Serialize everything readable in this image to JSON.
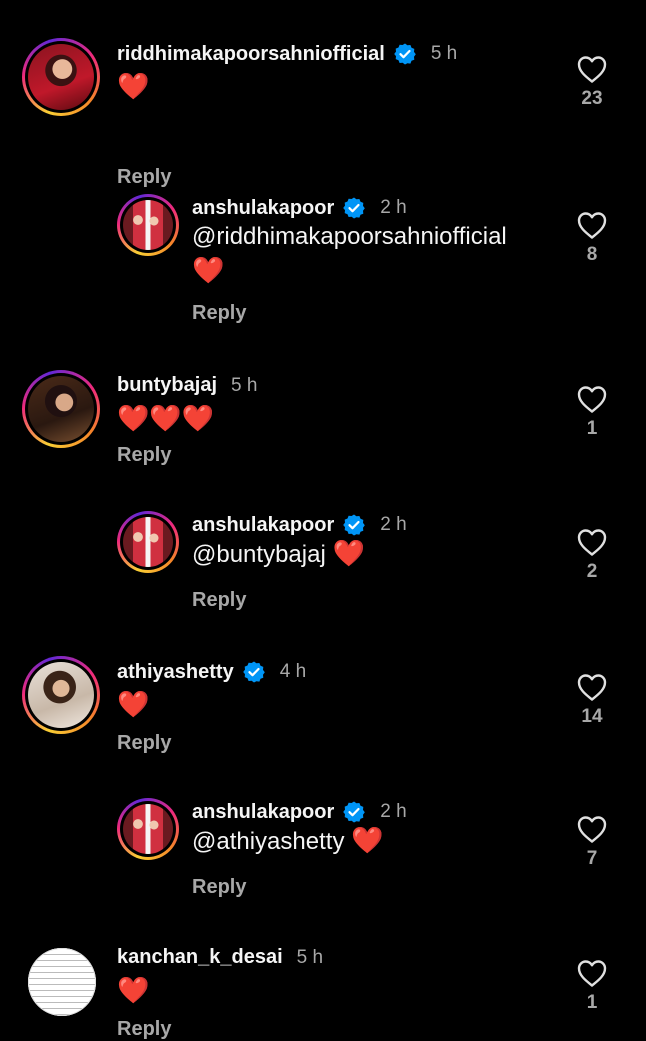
{
  "comments": [
    {
      "username": "riddhimakapoorsahniofficial",
      "verified": true,
      "time": "5 h",
      "body": "❤️",
      "reply_label": "Reply",
      "likes": "23"
    },
    {
      "username": "anshulakapoor",
      "verified": true,
      "time": "2 h",
      "mention": "@riddhimakapoorsahniofficial",
      "body": "❤️",
      "reply_label": "Reply",
      "likes": "8"
    },
    {
      "username": "buntybajaj",
      "verified": false,
      "time": "5 h",
      "body": "❤️❤️❤️",
      "reply_label": "Reply",
      "likes": "1"
    },
    {
      "username": "anshulakapoor",
      "verified": true,
      "time": "2 h",
      "mention": "@buntybajaj",
      "body": "❤️",
      "reply_label": "Reply",
      "likes": "2"
    },
    {
      "username": "athiyashetty",
      "verified": true,
      "time": "4 h",
      "body": "❤️",
      "reply_label": "Reply",
      "likes": "14"
    },
    {
      "username": "anshulakapoor",
      "verified": true,
      "time": "2 h",
      "mention": "@athiyashetty",
      "body": "❤️",
      "reply_label": "Reply",
      "likes": "7"
    },
    {
      "username": "kanchan_k_desai",
      "verified": false,
      "time": "5 h",
      "body": "❤️",
      "reply_label": "Reply",
      "likes": "1"
    }
  ],
  "icons": {
    "verified": "verified-badge-icon",
    "like": "heart-outline-icon"
  },
  "colors": {
    "background": "#000000",
    "verified_blue": "#0095f6",
    "secondary_text": "#a8a8a8",
    "heart_red": "#ff2d3a"
  }
}
